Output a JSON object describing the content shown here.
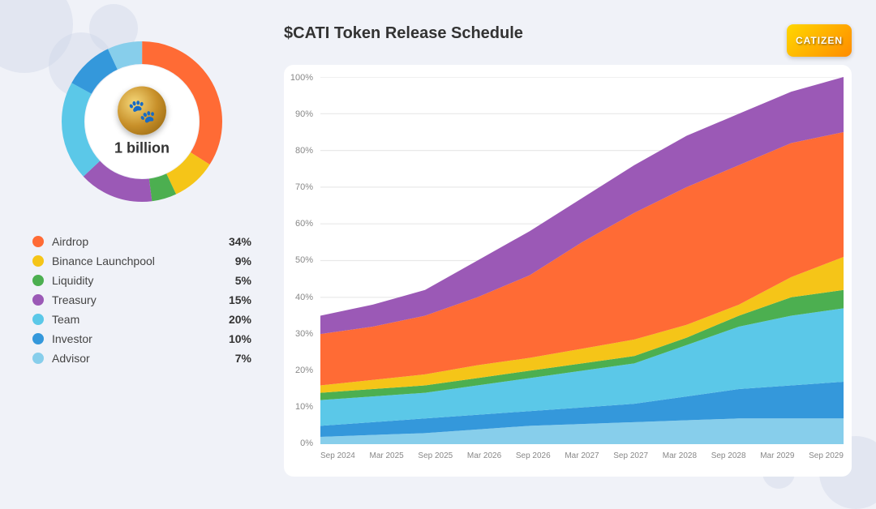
{
  "page": {
    "title": "$CATI Token Release Schedule",
    "total": "1 billion"
  },
  "logo": {
    "text": "CATIZEN"
  },
  "legend": [
    {
      "name": "Airdrop",
      "pct": "34%",
      "color": "#FF6B35"
    },
    {
      "name": "Binance Launchpool",
      "pct": "9%",
      "color": "#F5C518"
    },
    {
      "name": "Liquidity",
      "pct": "5%",
      "color": "#4CAF50"
    },
    {
      "name": "Treasury",
      "pct": "15%",
      "color": "#9B59B6"
    },
    {
      "name": "Team",
      "pct": "20%",
      "color": "#5BC8E8"
    },
    {
      "name": "Investor",
      "pct": "10%",
      "color": "#3498DB"
    },
    {
      "name": "Advisor",
      "pct": "7%",
      "color": "#87CEEB"
    }
  ],
  "yAxis": [
    "100%",
    "90%",
    "80%",
    "70%",
    "60%",
    "50%",
    "40%",
    "30%",
    "20%",
    "10%",
    "0%"
  ],
  "xAxis": [
    "Sep 2024",
    "Mar 2025",
    "Sep 2025",
    "Mar 2026",
    "Sep 2026",
    "Mar 2027",
    "Sep 2027",
    "Mar 2028",
    "Sep 2028",
    "Mar 2029",
    "Sep 2029"
  ]
}
